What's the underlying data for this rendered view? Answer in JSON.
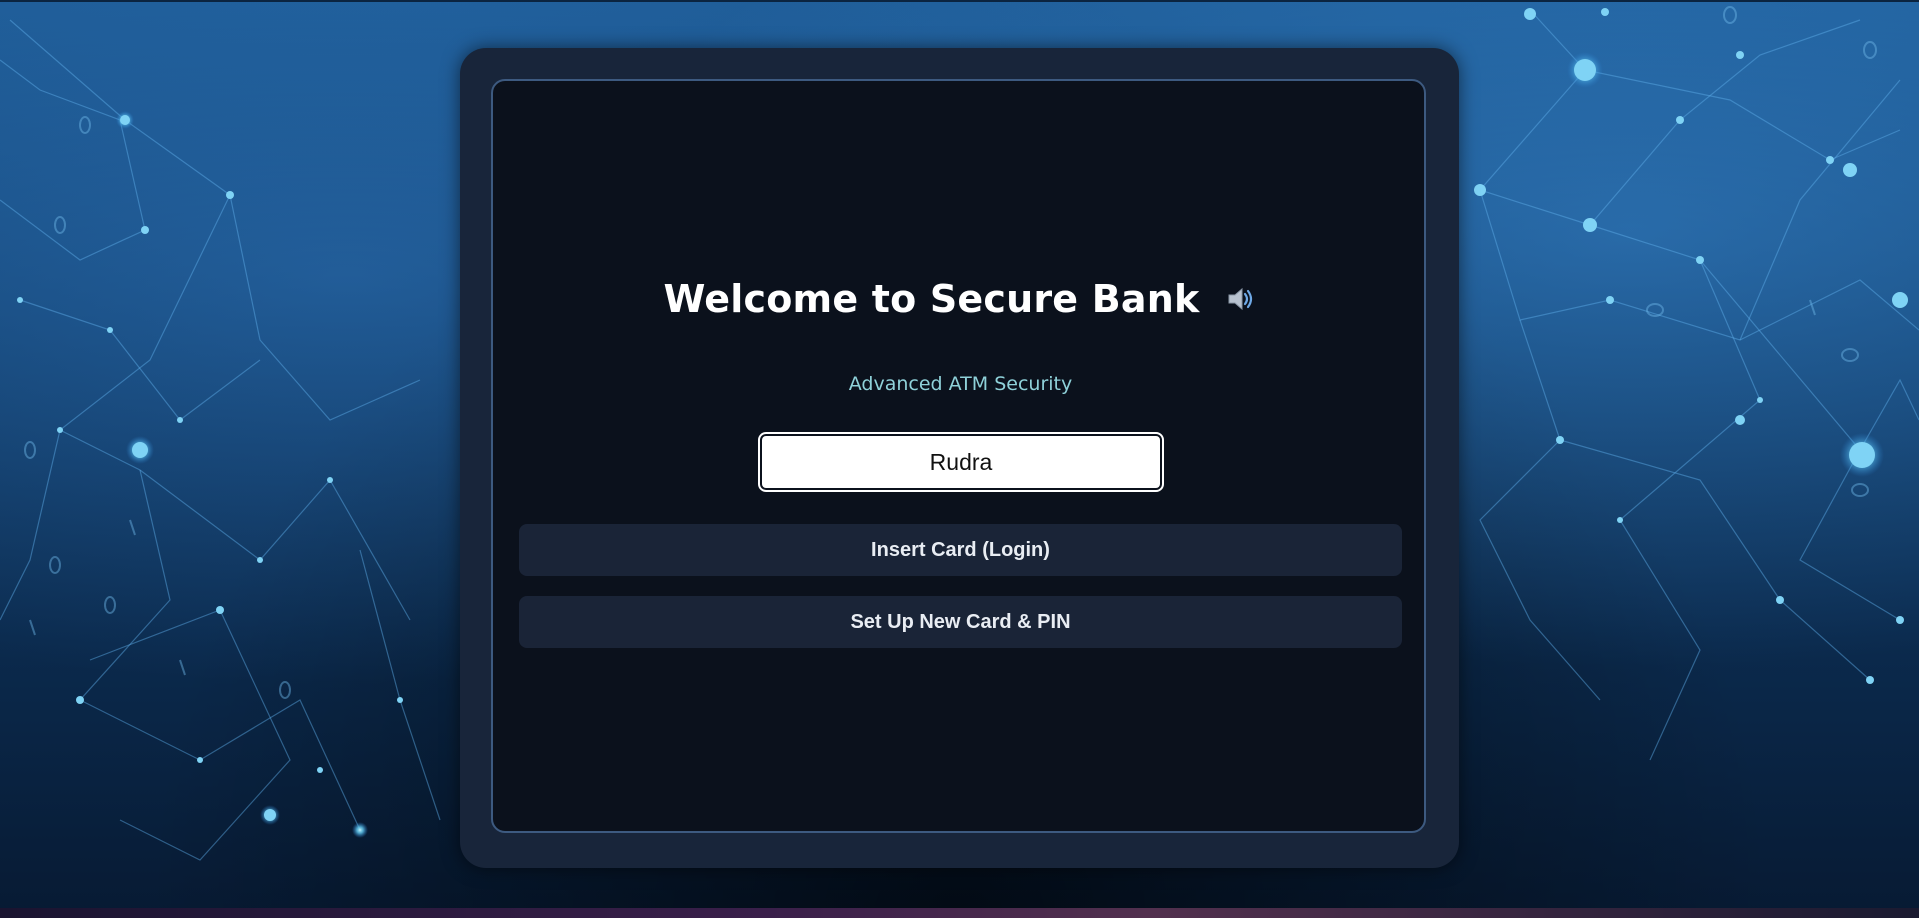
{
  "page": {
    "title": "Welcome to Secure Bank",
    "subtitle": "Advanced ATM Security"
  },
  "login": {
    "card_input_value": "Rudra",
    "insert_card_label": "Insert Card (Login)",
    "setup_label": "Set Up New Card & PIN"
  },
  "icons": {
    "audio": "speaker-icon"
  },
  "colors": {
    "frame": "#18253a",
    "screen": "#0b111c",
    "subtitle": "#8fd1d9",
    "button_bg": "#1a2437",
    "screen_border": "#3d5a80"
  }
}
